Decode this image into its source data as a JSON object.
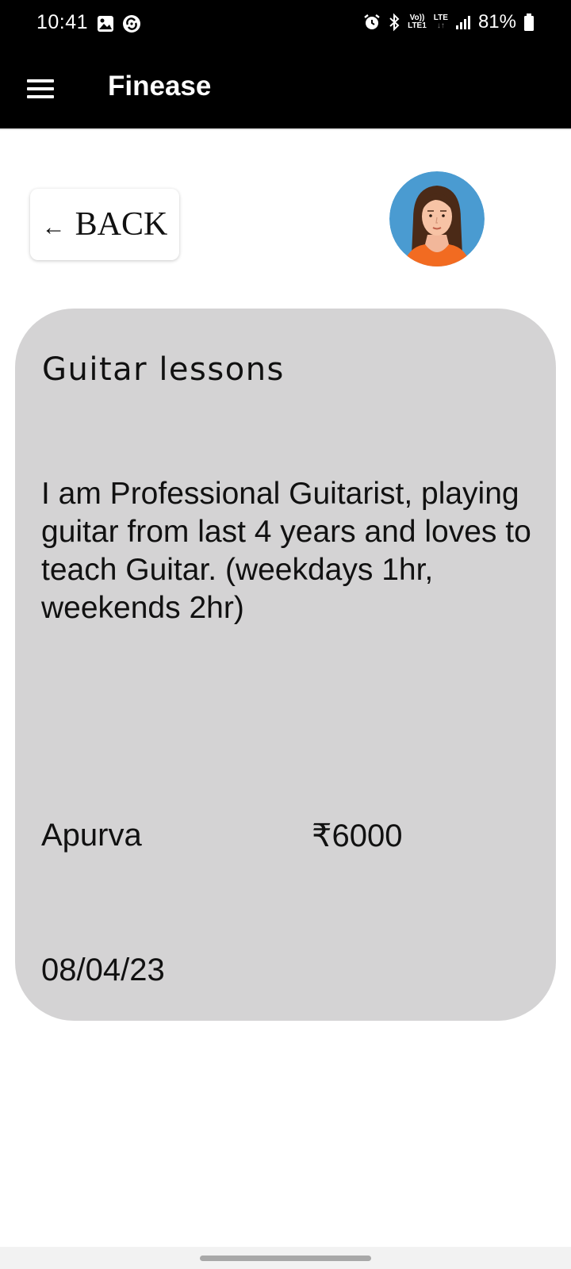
{
  "status_bar": {
    "time": "10:41",
    "battery": "81%",
    "volte_line1": "Vo))",
    "volte_line2": "LTE1",
    "lte_label": "LTE",
    "lte_arrows": "↓↑"
  },
  "app_bar": {
    "title": "Finease"
  },
  "back_button": {
    "arrow": "←",
    "label": "BACK"
  },
  "card": {
    "title": "Guitar lessons",
    "description": "I am Professional Guitarist, playing guitar from last 4 years and loves to teach Guitar. (weekdays 1hr, weekends 2hr)",
    "name": "Apurva",
    "price": "₹6000",
    "date": "08/04/23"
  },
  "colors": {
    "status_bar_bg": "#000000",
    "card_bg": "#d4d3d4",
    "avatar_bg": "#4a9bd1",
    "avatar_shirt": "#f26b21"
  },
  "icons": {
    "menu": "hamburger-menu-icon",
    "gallery": "gallery-icon",
    "sync": "sync-icon",
    "alarm": "alarm-icon",
    "bluetooth": "bluetooth-icon",
    "signal": "signal-icon",
    "battery": "battery-icon"
  }
}
